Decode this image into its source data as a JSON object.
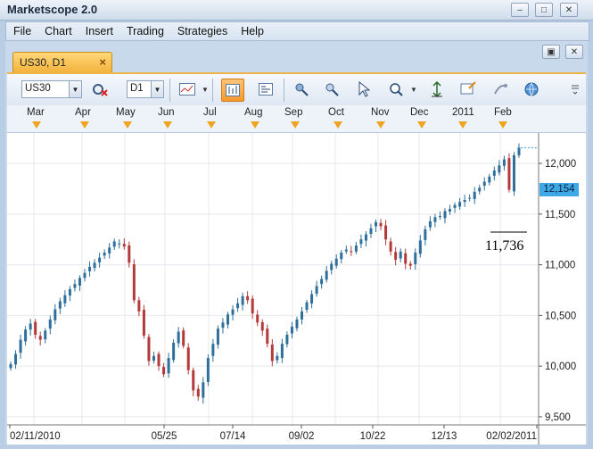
{
  "window": {
    "title": "Marketscope 2.0"
  },
  "menu": [
    "File",
    "Chart",
    "Insert",
    "Trading",
    "Strategies",
    "Help"
  ],
  "tab": {
    "label": "US30, D1"
  },
  "toolbar": {
    "instrument": "US30",
    "timeframe": "D1"
  },
  "months": [
    "Mar",
    "Apr",
    "May",
    "Jun",
    "Jul",
    "Aug",
    "Sep",
    "Oct",
    "Nov",
    "Dec",
    "2011",
    "Feb"
  ],
  "chart_data": {
    "type": "candlestick",
    "title": "",
    "y_ticks": [
      9500,
      10000,
      10500,
      11000,
      11500,
      12000
    ],
    "y_tick_labels": [
      "9,500",
      "10,000",
      "10,500",
      "11,000",
      "11,500",
      "12,000"
    ],
    "x_tick_labels": [
      "02/11/2010",
      "05/25",
      "07/14",
      "09/02",
      "10/22",
      "12/13",
      "02/02/2011"
    ],
    "ylim": [
      9420,
      12300
    ],
    "last_price": "12,154",
    "annotation": "11,736",
    "colors": {
      "up": "#2f6f9c",
      "down": "#b43a3a",
      "grid": "#e4e8ee",
      "last_price": "#3fa8e6"
    },
    "close_series": [
      10020,
      10120,
      10260,
      10360,
      10420,
      10310,
      10260,
      10350,
      10460,
      10560,
      10640,
      10700,
      10760,
      10810,
      10870,
      10920,
      10980,
      11020,
      11070,
      11120,
      11170,
      11230,
      11210,
      11180,
      11020,
      10650,
      10540,
      10300,
      10050,
      10100,
      10000,
      9920,
      10080,
      10230,
      10340,
      10200,
      9960,
      9760,
      9700,
      9840,
      10080,
      10220,
      10370,
      10430,
      10510,
      10560,
      10620,
      10690,
      10650,
      10520,
      10430,
      10350,
      10220,
      10050,
      10100,
      10220,
      10310,
      10390,
      10460,
      10540,
      10630,
      10710,
      10790,
      10860,
      10940,
      11010,
      11060,
      11120,
      11150,
      11130,
      11190,
      11250,
      11300,
      11360,
      11420,
      11380,
      11250,
      11130,
      11050,
      11130,
      11010,
      10990,
      11120,
      11240,
      11350,
      11430,
      11470,
      11480,
      11530,
      11550,
      11590,
      11620,
      11640,
      11660,
      11720,
      11760,
      11820,
      11870,
      11930,
      11980,
      12040,
      11740,
      12080,
      12154
    ]
  }
}
